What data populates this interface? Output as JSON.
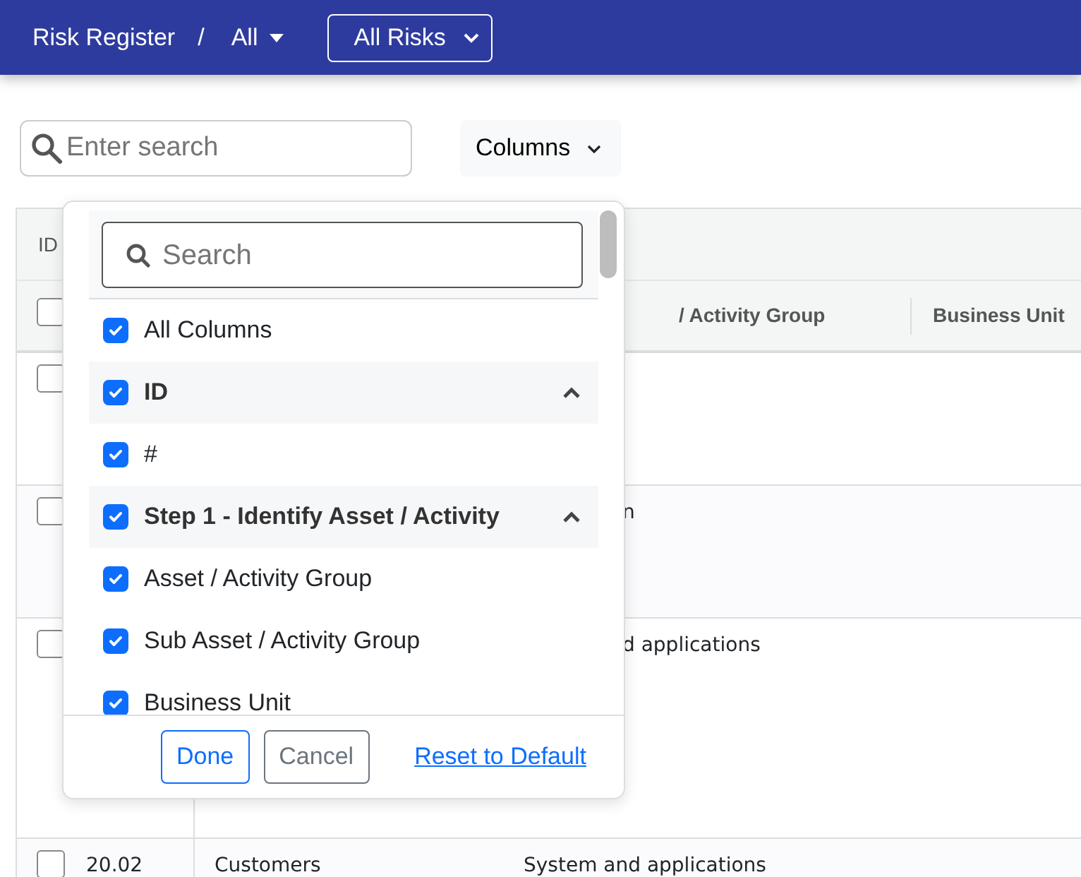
{
  "navbar": {
    "title": "Risk Register",
    "separator": "/",
    "filter": "All",
    "view_select": "All Risks"
  },
  "toolbar": {
    "search": {
      "placeholder": "Enter search"
    },
    "columns_button": "Columns"
  },
  "table": {
    "header_top": "ID",
    "select_all_checked": false,
    "columns": [
      "/ Activity Group",
      "Business Unit"
    ],
    "rows": [
      {
        "checked": false
      },
      {
        "checked": false,
        "column_4": "n"
      },
      {
        "checked": false,
        "column_4": "d applications"
      },
      {
        "checked": false,
        "id": "20.02",
        "column_3": "Customers",
        "column_4": "System and applications"
      }
    ]
  },
  "columns_menu": {
    "search": {
      "placeholder": "Search"
    },
    "items": [
      {
        "kind": "option",
        "label": "All Columns",
        "checked": true
      },
      {
        "kind": "group",
        "label": "ID",
        "checked": true,
        "expanded": true
      },
      {
        "kind": "option",
        "label": "#",
        "checked": true
      },
      {
        "kind": "group",
        "label": "Step 1 - Identify Asset / Activity",
        "checked": true,
        "expanded": true
      },
      {
        "kind": "option",
        "label": "Asset / Activity Group",
        "checked": true
      },
      {
        "kind": "option",
        "label": "Sub Asset / Activity Group",
        "checked": true
      },
      {
        "kind": "option",
        "label": "Business Unit",
        "checked": true
      }
    ],
    "buttons": [
      {
        "kind": "primary",
        "label": "Done"
      },
      {
        "kind": "secondary",
        "label": "Cancel"
      },
      {
        "kind": "link",
        "label": "Reset to Default"
      }
    ]
  }
}
